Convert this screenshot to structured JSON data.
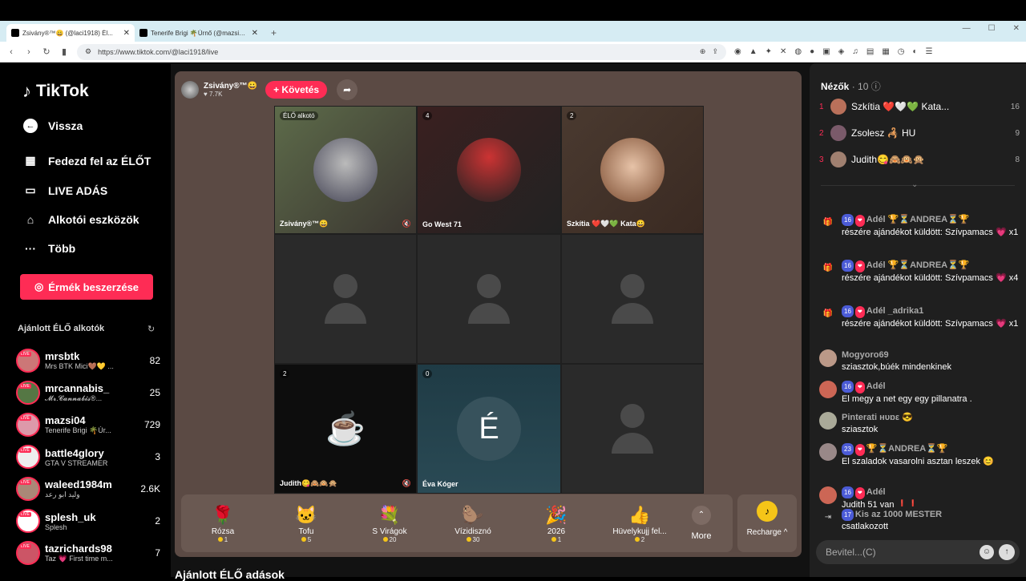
{
  "browser": {
    "tabs": [
      {
        "title": "Zsivány®™😀 (@laci1918) Él...",
        "active": true
      },
      {
        "title": "Tenerife Brigi 🌴Úrnő (@mazsi04) Él...",
        "active": false
      }
    ],
    "new_tab": "+",
    "url": "https://www.tiktok.com/@laci1918/live"
  },
  "sidebar": {
    "logo": "TikTok",
    "nav": [
      {
        "label": "Vissza",
        "icon": "back-arrow-icon"
      },
      {
        "label": "Fedezd fel az ÉLŐT",
        "icon": "calendar-icon"
      },
      {
        "label": "LIVE ADÁS",
        "icon": "camera-icon"
      },
      {
        "label": "Alkotói eszközök",
        "icon": "tools-icon"
      },
      {
        "label": "Több",
        "icon": "more-icon"
      }
    ],
    "coin_button": "Érmék beszerzése",
    "recommended_title": "Ajánlott ÉLŐ alkotók",
    "creators": [
      {
        "name": "mrsbtk",
        "sub": "Mrs BTK Mici🤎💛 ...",
        "count": "82"
      },
      {
        "name": "mrcannabis_",
        "sub": "𝓜𝓻.𝓒𝓪𝓷𝓷𝓪𝓫𝓲𝓼®...",
        "count": "25"
      },
      {
        "name": "mazsi04",
        "sub": "Tenerife Brigi 🌴Úr...",
        "count": "729"
      },
      {
        "name": "battle4glory",
        "sub": "GTA V STREAMER",
        "count": "3"
      },
      {
        "name": "waleed1984m",
        "sub": "وليد ابو رعد",
        "count": "2.6K"
      },
      {
        "name": "splesh_uk",
        "sub": "Splesh",
        "count": "2"
      },
      {
        "name": "tazrichards98",
        "sub": "Taz 💗 First time m...",
        "count": "7"
      }
    ]
  },
  "stage": {
    "host_name": "Zsivány®™😀",
    "host_likes": "♥ 7.7K",
    "follow_label": "+ Követés",
    "cells": [
      {
        "badge": "ÉLŐ alkotó",
        "label": "Zsivány®™😀",
        "type": "photo"
      },
      {
        "badge": "4",
        "label": "Go West 71",
        "type": "photo"
      },
      {
        "badge": "2",
        "label": "Szkítia ❤️🤍💚 Kata😀",
        "type": "photo"
      },
      {
        "badge": "",
        "label": "",
        "type": "empty"
      },
      {
        "badge": "",
        "label": "",
        "type": "empty"
      },
      {
        "badge": "",
        "label": "",
        "type": "empty"
      },
      {
        "badge": "2",
        "label": "Judith😋🙈🙉🙊",
        "type": "coffee"
      },
      {
        "badge": "0",
        "label": "Éva Kóger",
        "type": "letter",
        "letter": "É"
      },
      {
        "badge": "",
        "label": "",
        "type": "empty"
      }
    ],
    "gifts": [
      {
        "name": "Rózsa",
        "price": "1",
        "icon": "🌹"
      },
      {
        "name": "Tofu",
        "price": "5",
        "icon": "🐱"
      },
      {
        "name": "S Virágok",
        "price": "20",
        "icon": "💐"
      },
      {
        "name": "Vízidisznó",
        "price": "30",
        "icon": "🦫"
      },
      {
        "name": "2026",
        "price": "1",
        "icon": "🎉"
      },
      {
        "name": "Hüvelykujj fel...",
        "price": "2",
        "icon": "👍"
      }
    ],
    "more_label": "More",
    "recharge_label": "Recharge ^"
  },
  "below_title": "Ajánlott ÉLŐ adások",
  "right": {
    "viewers_title": "Nézők",
    "viewers_count": "· 10",
    "viewers": [
      {
        "rank": "1",
        "name": "Szkítia ❤️🤍💚 Kata...",
        "score": "16"
      },
      {
        "rank": "2",
        "name": "Zsolesz 🦂 HU",
        "score": "9"
      },
      {
        "rank": "3",
        "name": "Judith😋🙈🙉🙊",
        "score": "8"
      }
    ],
    "chat": [
      {
        "lvl": "16",
        "name": "Adél 🏆⏳ANDREA⏳🏆",
        "text": "részére ajándékot küldött: Szívpamacs 💗 x1",
        "icon": "gift"
      },
      {
        "lvl": "16",
        "name": "Adél 🏆⏳ANDREA⏳🏆",
        "text": "részére ajándékot küldött: Szívpamacs 💗 x4",
        "icon": "gift"
      },
      {
        "lvl": "16",
        "name": "Adél _adrika1",
        "text": "részére ajándékot küldött: Szívpamacs 💗 x1",
        "icon": "gift"
      },
      {
        "lvl": "",
        "name": "Mogyoro69",
        "text": "sziasztok,búék mindenkinek",
        "icon": "avatar"
      },
      {
        "lvl": "16",
        "name": "Adél",
        "text": "El megy a net egy egy pillanatra .",
        "icon": "avatar"
      },
      {
        "lvl": "",
        "name": "Pinterati нυɒε 😎",
        "text": "sziasztok",
        "icon": "avatar"
      },
      {
        "lvl": "23",
        "name": "🏆⏳ANDREA⏳🏆",
        "text": "El szaladok vasarolni asztan leszek 😊",
        "icon": "avatar"
      },
      {
        "lvl": "16",
        "name": "Adél",
        "text": "Judith 51 van ❗❗",
        "icon": "avatar"
      },
      {
        "lvl": "17",
        "name": "Kis az 1000 MESTER",
        "text": "csatlakozott",
        "icon": "join"
      }
    ],
    "input_placeholder": "Bevitel...(C)"
  }
}
